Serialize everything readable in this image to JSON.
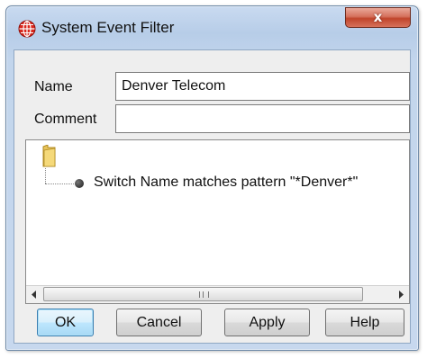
{
  "window": {
    "title": "System Event Filter",
    "close_label": "x"
  },
  "form": {
    "name_label": "Name",
    "name_value": "Denver Telecom",
    "comment_label": "Comment",
    "comment_value": ""
  },
  "tree": {
    "root_icon": "folder-icon",
    "nodes": [
      {
        "icon": "bullet-icon",
        "label": "Switch Name matches pattern \"*Denver*\""
      }
    ],
    "scroll_grip": "III"
  },
  "buttons": {
    "ok": "OK",
    "cancel": "Cancel",
    "apply": "Apply",
    "help": "Help"
  },
  "colors": {
    "titlebar": "#b7cde8",
    "close_button": "#c0442b",
    "default_button": "#bee6fd",
    "client": "#eeeeee"
  }
}
